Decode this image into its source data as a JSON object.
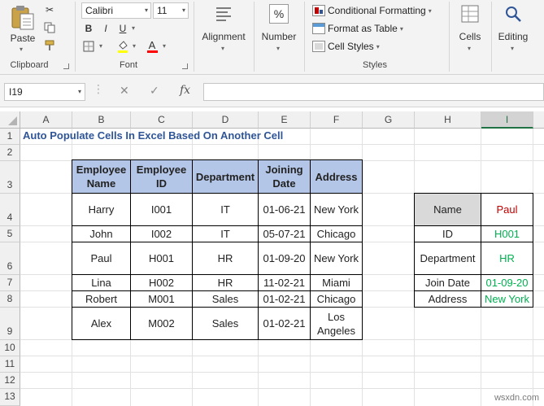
{
  "ribbon": {
    "clipboard": {
      "paste_label": "Paste",
      "group_label": "Clipboard"
    },
    "font": {
      "font_name": "Calibri",
      "font_size": "11",
      "group_label": "Font",
      "bold": "B",
      "italic": "I",
      "underline": "U"
    },
    "alignment": {
      "label": "Alignment"
    },
    "number": {
      "label": "Number",
      "icon_glyph": "%"
    },
    "styles": {
      "conditional_formatting": "Conditional Formatting",
      "format_as_table": "Format as Table",
      "cell_styles": "Cell Styles",
      "group_label": "Styles"
    },
    "cells": {
      "label": "Cells"
    },
    "editing": {
      "label": "Editing"
    }
  },
  "formula_bar": {
    "name_box": "I19",
    "fx": "fx",
    "formula": ""
  },
  "columns": [
    "A",
    "B",
    "C",
    "D",
    "E",
    "F",
    "G",
    "H",
    "I"
  ],
  "selected_column": "I",
  "rows": [
    "1",
    "2",
    "3",
    "4",
    "5",
    "6",
    "7",
    "8",
    "9",
    "10",
    "11",
    "12",
    "13"
  ],
  "sheet": {
    "title": "Auto Populate Cells In Excel Based On Another Cell",
    "table": {
      "headers": [
        "Employee Name",
        "Employee ID",
        "Department",
        "Joining Date",
        "Address"
      ],
      "rows": [
        [
          "Harry",
          "I001",
          "IT",
          "01-06-21",
          "New York"
        ],
        [
          "John",
          "I002",
          "IT",
          "05-07-21",
          "Chicago"
        ],
        [
          "Paul",
          "H001",
          "HR",
          "01-09-20",
          "New York"
        ],
        [
          "Lina",
          "H002",
          "HR",
          "11-02-21",
          "Miami"
        ],
        [
          "Robert",
          "M001",
          "Sales",
          "01-02-21",
          "Chicago"
        ],
        [
          "Alex",
          "M002",
          "Sales",
          "01-02-21",
          "Los Angeles"
        ]
      ]
    },
    "lookup": {
      "labels": [
        "Name",
        "ID",
        "Department",
        "Join Date",
        "Address"
      ],
      "values": [
        "Paul",
        "H001",
        "HR",
        "01-09-20",
        "New York"
      ]
    }
  },
  "colors": {
    "header_fill": "#b4c6e7",
    "label_fill": "#d9d9d9",
    "title_text": "#2f5597",
    "input_value": "#c00000",
    "result_value": "#00b050",
    "excel_green": "#217346"
  },
  "watermark": "wsxdn.com"
}
